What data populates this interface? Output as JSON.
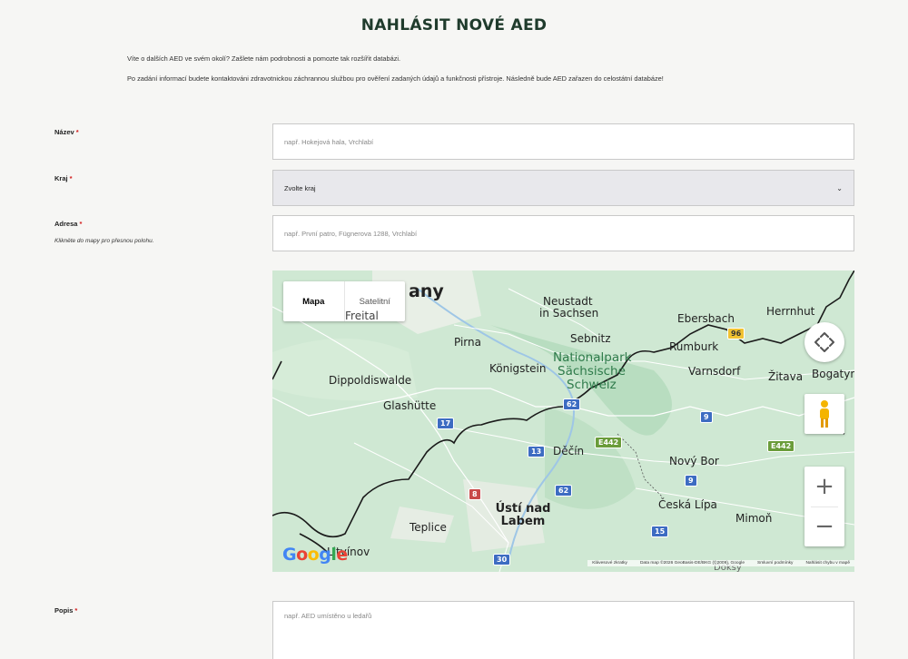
{
  "page": {
    "title": "NAHLÁSIT NOVÉ AED",
    "intro_1": "Víte o dalších AED ve svém okolí? Zašlete nám podrobnosti a pomozte tak rozšířit databázi.",
    "intro_2": "Po zadání informací budete kontaktováni zdravotnickou záchrannou službou pro ověření zadaných údajů a funkčnosti přístroje. Následně bude AED zařazen do celostátní databáze!"
  },
  "form": {
    "required_mark": "*",
    "name": {
      "label": "Název",
      "placeholder": "např. Hokejová hala, Vrchlabí"
    },
    "region": {
      "label": "Kraj",
      "value": "Zvolte kraj"
    },
    "address": {
      "label": "Adresa",
      "hint": "Klikněte do mapy pro přesnou polohu.",
      "placeholder": "např. První patro, Fügnerova 1288, Vrchlabí"
    },
    "description": {
      "label": "Popis",
      "placeholder": "např. AED umístěno u ledařů"
    }
  },
  "map": {
    "type_map": "Mapa",
    "type_satellite": "Satelitní",
    "logo": "Google",
    "attribution": {
      "shortcuts": "Klávesové zkratky",
      "data": "Data map ©2026 GeoBasis-DE/BKG (©2009), Google",
      "terms": "Smluvní podmínky",
      "report": "Nahlásit chybu v mapě"
    },
    "places": [
      {
        "name": "Neustadt in Sachsen",
        "line1": "Neustadt",
        "line2": "in Sachsen"
      },
      {
        "name": "Ebersbach"
      },
      {
        "name": "Herrnhut"
      },
      {
        "name": "Pirna"
      },
      {
        "name": "Sebnitz"
      },
      {
        "name": "Rumburk"
      },
      {
        "name": "Königstein"
      },
      {
        "name": "Varnsdorf"
      },
      {
        "name": "Žitava"
      },
      {
        "name": "Bogatyn"
      },
      {
        "name": "Dippoldiswalde"
      },
      {
        "name": "Glashütte"
      },
      {
        "name": "Děčín"
      },
      {
        "name": "Nový Bor"
      },
      {
        "name": "Ústí nad Labem"
      },
      {
        "name": "Česká Lípa"
      },
      {
        "name": "Teplice"
      },
      {
        "name": "Mimoň"
      },
      {
        "name": "Litvínov"
      },
      {
        "name": "Freital"
      },
      {
        "name": "Doksy"
      }
    ],
    "park": [
      "Nationalpark",
      "Sächsische",
      "Schweiz"
    ],
    "city_partial": "any",
    "roads": [
      "96",
      "17",
      "62",
      "E442",
      "9",
      "13",
      "8",
      "62",
      "9",
      "15",
      "30",
      "E442"
    ]
  }
}
